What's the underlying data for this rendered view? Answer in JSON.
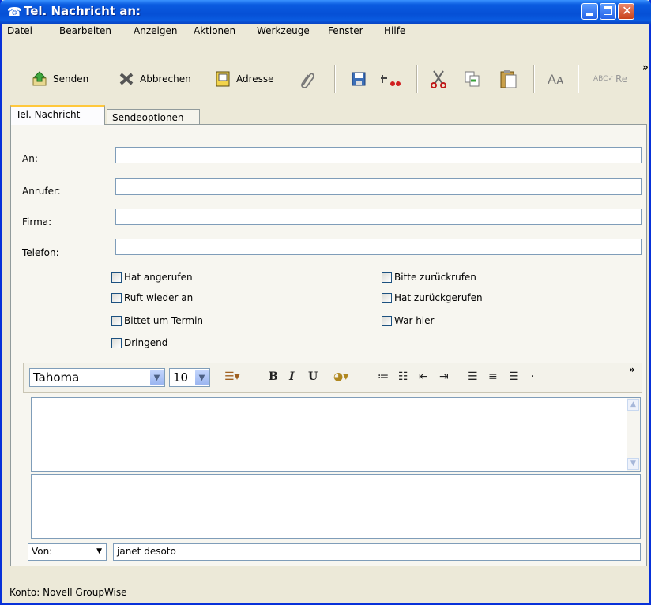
{
  "window": {
    "title": "Tel. Nachricht an:"
  },
  "menu": [
    "Datei",
    "Bearbeiten",
    "Anzeigen",
    "Aktionen",
    "Werkzeuge",
    "Fenster",
    "Hilfe"
  ],
  "toolbar": {
    "send": "Senden",
    "cancel": "Abbrechen",
    "address": "Adresse",
    "spell": "Re",
    "more": "»"
  },
  "tabs": [
    "Tel. Nachricht",
    "Sendeoptionen"
  ],
  "form": {
    "to_label": "An:",
    "caller_label": "Anrufer:",
    "company_label": "Firma:",
    "phone_label": "Telefon:",
    "to_value": "",
    "caller_value": "",
    "company_value": "",
    "phone_value": ""
  },
  "checkboxes": {
    "left": [
      "Hat angerufen",
      "Ruft wieder an",
      "Bittet um Termin",
      "Dringend"
    ],
    "right": [
      "Bitte zurückrufen",
      "Hat zurückgerufen",
      "War hier"
    ]
  },
  "editor": {
    "font": "Tahoma",
    "size": "10",
    "more": "»"
  },
  "from": {
    "label": "Von:",
    "value": "janet desoto"
  },
  "status": {
    "account": "Konto: Novell GroupWise"
  },
  "colors": {
    "titlebar": "#0A5BE0",
    "chrome": "#ECE9D8",
    "accent_tab": "#FFC83C"
  }
}
